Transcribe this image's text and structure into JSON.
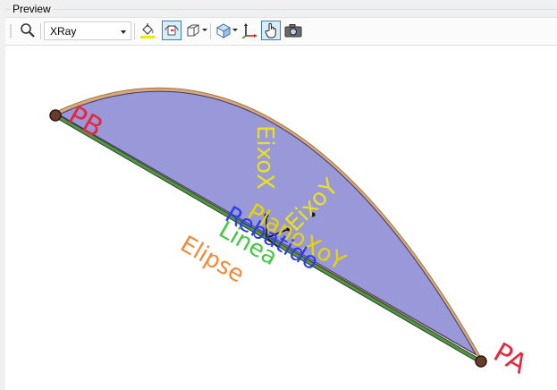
{
  "panel": {
    "title": "Preview"
  },
  "toolbar": {
    "display_mode": {
      "selected": "XRay"
    }
  },
  "scene": {
    "labels": {
      "pa": "PA",
      "pb": "PB",
      "elipse": "Elipse",
      "plano_xoy": "PlanoXoY",
      "rebatido": "Rebatido",
      "linea": "Linea",
      "eixo_x": "EixoX",
      "eixo_y": "EixoY"
    },
    "colors": {
      "fill": "#9999d9",
      "outline": "#d8a878",
      "line": "#4c9a3c",
      "pa_pb": "#e6283c",
      "elipse": "#f28a3a",
      "plano": "#e6d400",
      "rebatido": "#2c3cf0",
      "linea": "#40c840",
      "eixo": "#e8e020"
    }
  }
}
